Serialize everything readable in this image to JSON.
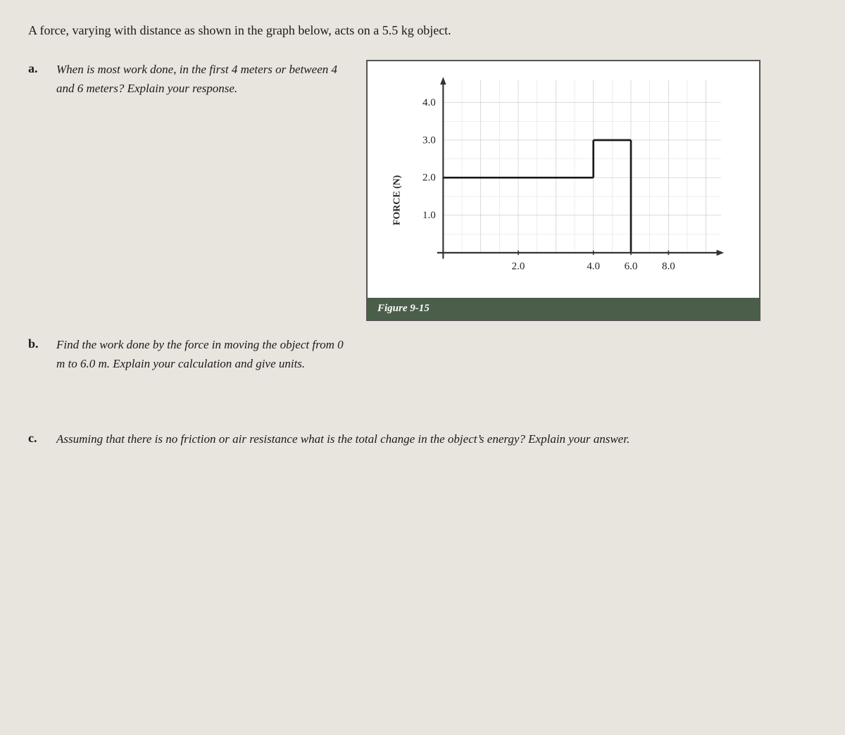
{
  "intro": {
    "text": "A force, varying with distance as shown in the graph below, acts on a 5.5 kg object."
  },
  "questions": {
    "a": {
      "label": "a.",
      "text": "When is most work done, in the first 4 meters or between 4 and 6 meters? Explain your response."
    },
    "b": {
      "label": "b.",
      "text": "Find the work done by the force in moving the object from 0 m to 6.0 m. Explain your calculation and give units."
    },
    "c": {
      "label": "c.",
      "text": "Assuming that there is no friction or air resistance what is the total change in the object’s energy? Explain your answer."
    }
  },
  "graph": {
    "y_axis_label": "FORCE (N)",
    "y_ticks": [
      "4.0",
      "3.0",
      "2.0",
      "1.0"
    ],
    "x_ticks": [
      "2.0",
      "4.0",
      "6.0",
      "8.0"
    ],
    "figure_caption": "Figure 9-15"
  }
}
